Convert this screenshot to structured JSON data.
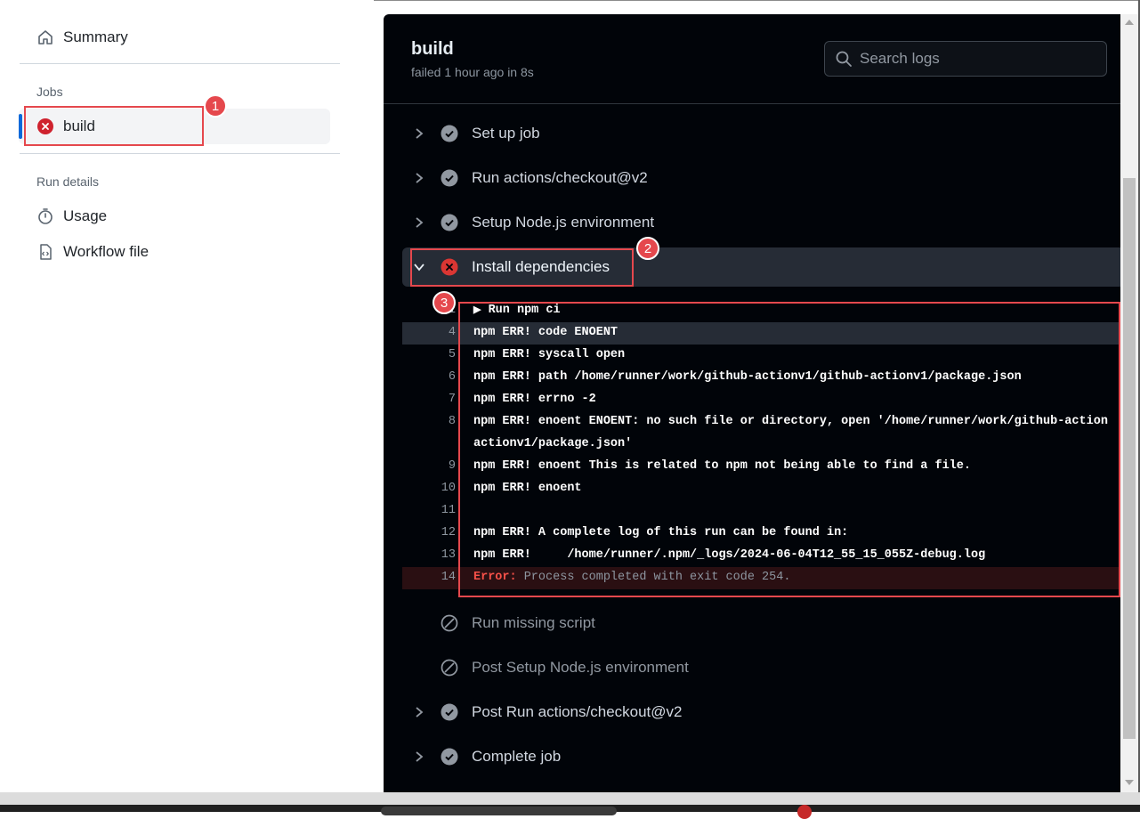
{
  "sidebar": {
    "summary_label": "Summary",
    "jobs_heading": "Jobs",
    "job_build_label": "build",
    "run_details_heading": "Run details",
    "usage_label": "Usage",
    "workflow_file_label": "Workflow file"
  },
  "header": {
    "job_title": "build",
    "job_subtitle": "failed 1 hour ago in 8s",
    "search_placeholder": "Search logs"
  },
  "steps_before": [
    {
      "label": "Set up job",
      "status": "success"
    },
    {
      "label": "Run actions/checkout@v2",
      "status": "success"
    },
    {
      "label": "Setup Node.js environment",
      "status": "success"
    }
  ],
  "expanded_step": {
    "label": "Install dependencies",
    "status": "failure"
  },
  "log": {
    "group_label": "Run npm ci",
    "lines": [
      {
        "num": "4",
        "text": "npm ERR! code ENOENT"
      },
      {
        "num": "5",
        "text": "npm ERR! syscall open"
      },
      {
        "num": "6",
        "text": "npm ERR! path /home/runner/work/github-actionv1/github-actionv1/package.json"
      },
      {
        "num": "7",
        "text": "npm ERR! errno -2"
      },
      {
        "num": "8",
        "text": "npm ERR! enoent ENOENT: no such file or directory, open '/home/runner/work/github-action"
      },
      {
        "num": "",
        "text": "actionv1/package.json'"
      },
      {
        "num": "9",
        "text": "npm ERR! enoent This is related to npm not being able to find a file."
      },
      {
        "num": "10",
        "text": "npm ERR! enoent"
      },
      {
        "num": "11",
        "text": ""
      },
      {
        "num": "12",
        "text": "npm ERR! A complete log of this run can be found in:"
      },
      {
        "num": "13",
        "text": "npm ERR!     /home/runner/.npm/_logs/2024-06-04T12_55_15_055Z-debug.log"
      }
    ],
    "error_line": {
      "num": "14",
      "label": "Error:",
      "message": " Process completed with exit code 254."
    }
  },
  "steps_after": [
    {
      "label": "Run missing script",
      "status": "skipped"
    },
    {
      "label": "Post Setup Node.js environment",
      "status": "skipped"
    },
    {
      "label": "Post Run actions/checkout@v2",
      "status": "success"
    },
    {
      "label": "Complete job",
      "status": "success"
    }
  ],
  "callouts": [
    "1",
    "2",
    "3"
  ],
  "colors": {
    "panel_bg": "#010409",
    "failure_red": "#da3633",
    "callout_red": "#e5484d",
    "active_blue": "#0969da"
  }
}
